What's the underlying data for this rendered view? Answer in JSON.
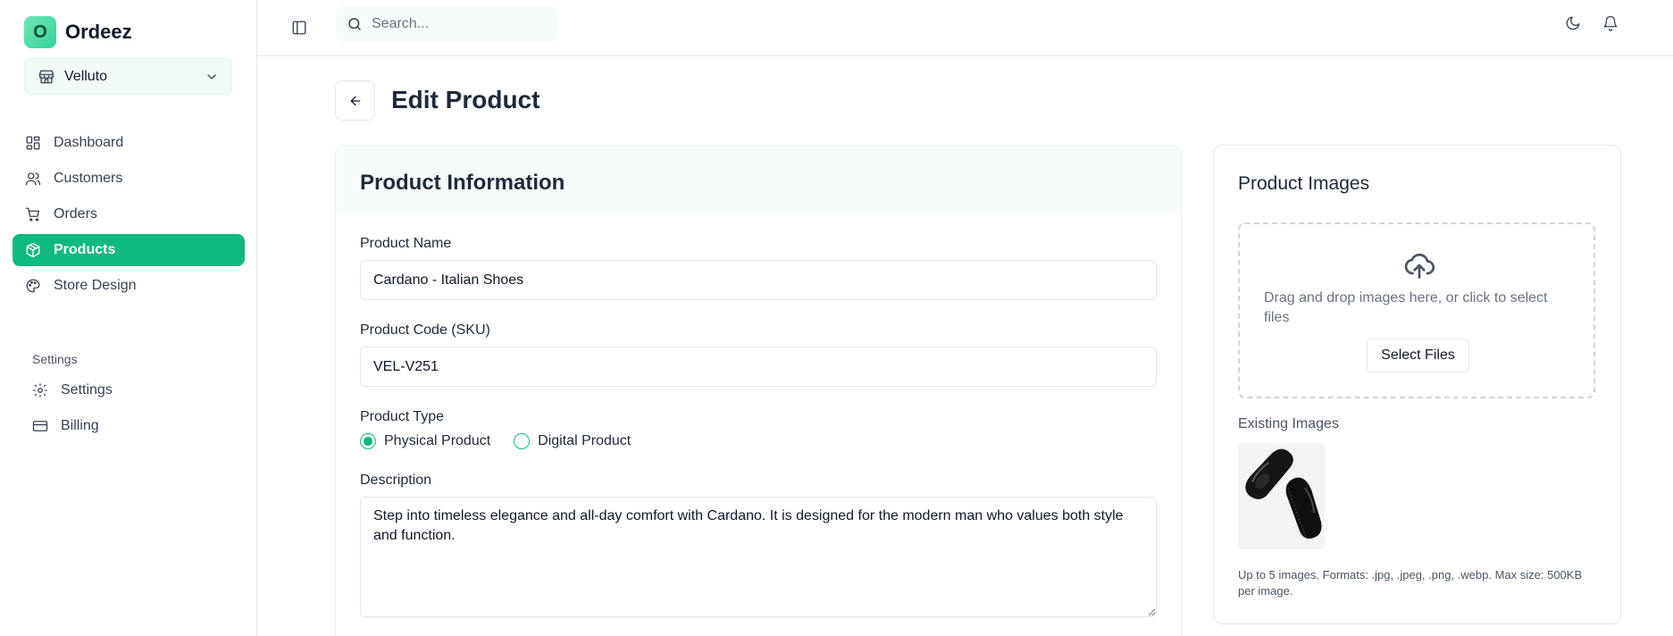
{
  "brand": {
    "logo_letter": "O",
    "name": "Ordeez"
  },
  "store_selector": {
    "value": "Velluto"
  },
  "nav": {
    "items": [
      {
        "label": "Dashboard",
        "icon": "dashboard-icon"
      },
      {
        "label": "Customers",
        "icon": "users-icon"
      },
      {
        "label": "Orders",
        "icon": "cart-icon"
      },
      {
        "label": "Products",
        "icon": "box-icon",
        "active": true
      },
      {
        "label": "Store Design",
        "icon": "palette-icon"
      }
    ],
    "settings_heading": "Settings",
    "settings_items": [
      {
        "label": "Settings",
        "icon": "gear-icon"
      },
      {
        "label": "Billing",
        "icon": "credit-card-icon"
      }
    ]
  },
  "search": {
    "placeholder": "Search..."
  },
  "page": {
    "title": "Edit Product"
  },
  "product_info": {
    "title": "Product Information",
    "name_label": "Product Name",
    "name_value": "Cardano - Italian Shoes",
    "sku_label": "Product Code (SKU)",
    "sku_value": "VEL-V251",
    "type_label": "Product Type",
    "type_options": [
      "Physical Product",
      "Digital Product"
    ],
    "type_selected": "Physical Product",
    "description_label": "Description",
    "description_value": "Step into timeless elegance and all-day comfort with Cardano. It is designed for the modern man who values both style and function."
  },
  "product_images": {
    "title": "Product Images",
    "dropzone_text": "Drag and drop images here, or click to select files",
    "select_button": "Select Files",
    "existing_label": "Existing Images",
    "note": "Up to 5 images. Formats: .jpg, .jpeg, .png, .webp. Max size: 500KB per image."
  },
  "colors": {
    "accent": "#10b981",
    "border": "#e5e7eb",
    "text": "#1f2937"
  }
}
